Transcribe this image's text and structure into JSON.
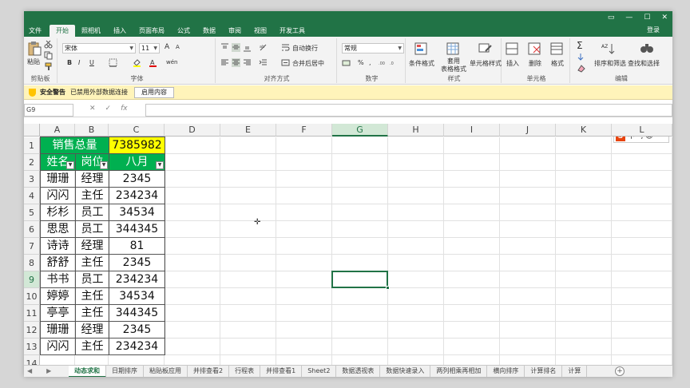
{
  "window": {
    "title": ""
  },
  "ribbon_tabs": [
    "文件",
    "开始",
    "照相机",
    "插入",
    "页面布局",
    "公式",
    "数据",
    "审阅",
    "视图",
    "开发工具"
  ],
  "active_tab_index": 1,
  "login_label": "登录",
  "clipboard": {
    "paste_label": "粘贴",
    "group_label": "剪贴板"
  },
  "font": {
    "name": "宋体",
    "size": "11",
    "grow": "A",
    "shrink": "A",
    "bold": "B",
    "italic": "I",
    "underline": "U",
    "wen": "wén",
    "group_label": "字体"
  },
  "alignment": {
    "wrap_label": "自动换行",
    "merge_label": "合并后居中",
    "group_label": "对齐方式"
  },
  "number": {
    "format": "常规",
    "percent": "%",
    "comma": ",",
    "group_label": "数字"
  },
  "styles": {
    "conditional": "条件格式",
    "table_format": "套用\n表格格式",
    "cell_styles": "单元格样式",
    "group_label": "样式"
  },
  "cells": {
    "insert": "插入",
    "delete": "删除",
    "format": "格式",
    "group_label": "单元格"
  },
  "editing": {
    "sort_filter": "排序和筛选",
    "find_select": "查找和选择",
    "group_label": "编辑"
  },
  "security_bar": {
    "title": "安全警告",
    "message": "已禁用外部数据连接",
    "enable_button": "启用内容"
  },
  "formula_bar": {
    "name_box": "G9",
    "fx": "fx",
    "cancel": "✕",
    "confirm": "✓",
    "value": ""
  },
  "ime": {
    "logo": "S",
    "label": "中",
    "extra": "°, ☺"
  },
  "columns": [
    "A",
    "B",
    "C",
    "D",
    "E",
    "F",
    "G",
    "H",
    "I",
    "J",
    "K",
    "L"
  ],
  "selected_column": "G",
  "rows": [
    "1",
    "2",
    "3",
    "4",
    "5",
    "6",
    "7",
    "8",
    "9",
    "10",
    "11",
    "12",
    "13",
    "14"
  ],
  "selected_row": "9",
  "sheet": {
    "total_label": "销售总量",
    "total_value": "7385982",
    "headers": [
      "姓名",
      "岗位",
      "八月"
    ],
    "data": [
      [
        "珊珊",
        "经理",
        "2345"
      ],
      [
        "闪闪",
        "主任",
        "234234"
      ],
      [
        "杉杉",
        "员工",
        "34534"
      ],
      [
        "思思",
        "员工",
        "344345"
      ],
      [
        "诗诗",
        "经理",
        "81"
      ],
      [
        "舒舒",
        "主任",
        "2345"
      ],
      [
        "书书",
        "员工",
        "234234"
      ],
      [
        "婷婷",
        "主任",
        "34534"
      ],
      [
        "亭亭",
        "主任",
        "344345"
      ],
      [
        "珊珊",
        "经理",
        "2345"
      ],
      [
        "闪闪",
        "主任",
        "234234"
      ]
    ]
  },
  "sheet_tabs": [
    "动态求和",
    "日期排序",
    "粘贴板应用",
    "并排查看2",
    "行程表",
    "并排查看1",
    "Sheet2",
    "数据透视表",
    "数据快速录入",
    "两列相乘再相加",
    "横向排序",
    "计算排名",
    "计算"
  ],
  "active_sheet_index": 0,
  "add_sheet": "+",
  "colors": {
    "brand_green": "#217346",
    "header_green": "#00b050",
    "total_yellow": "#ffff00"
  }
}
